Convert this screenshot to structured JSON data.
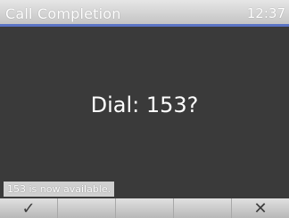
{
  "header": {
    "title": "Call Completion",
    "time": "12:37"
  },
  "main": {
    "prompt": "Dial: 153?"
  },
  "notification": {
    "text": "153 is now available."
  },
  "softkeys": [
    {
      "label": "✓",
      "icon": "checkmark-icon"
    },
    {
      "label": ""
    },
    {
      "label": ""
    },
    {
      "label": ""
    },
    {
      "label": "✕",
      "icon": "close-icon"
    }
  ],
  "colors": {
    "accent": "#5a73c4",
    "background": "#3a3a3a"
  }
}
